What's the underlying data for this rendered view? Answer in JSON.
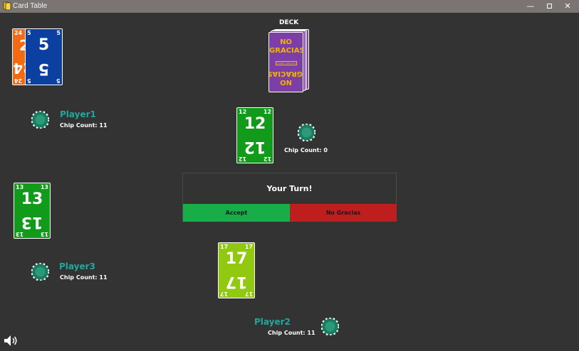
{
  "window": {
    "title": "Card Table",
    "min_label": "—",
    "close_label": "✕",
    "app_icon": "card-table-app-icon"
  },
  "deck": {
    "label": "DECK",
    "brand_top": "NO GRACIAS",
    "brand_bottom": "NO GRACIAS",
    "strip_text": "FORGET GRACIAS"
  },
  "cards": {
    "c24": {
      "value": "24",
      "color": "#f26a12"
    },
    "c5": {
      "value": "5",
      "color": "#0b3fa0"
    },
    "c12": {
      "value": "12",
      "color": "#129a1a"
    },
    "c13": {
      "value": "13",
      "color": "#129a1a"
    },
    "c17": {
      "value": "17",
      "color": "#90c910"
    }
  },
  "center": {
    "chip_count": "Chip Count: 0"
  },
  "players": [
    {
      "name": "Player1",
      "chip_count": "Chip Count: 11"
    },
    {
      "name": "Player3",
      "chip_count": "Chip Count: 11"
    },
    {
      "name": "Player2",
      "chip_count": "Chip Count: 11"
    }
  ],
  "turn": {
    "message": "Your Turn!",
    "accept_label": "Accept",
    "reject_label": "No Gracias"
  },
  "colors": {
    "table": "#333333",
    "accent_teal": "#22a89a",
    "accept": "#17ad48",
    "reject": "#be1e1e",
    "deck": "#7d3ea8"
  },
  "icons": {
    "chip": "poker-chip-icon",
    "speaker": "speaker-icon"
  }
}
